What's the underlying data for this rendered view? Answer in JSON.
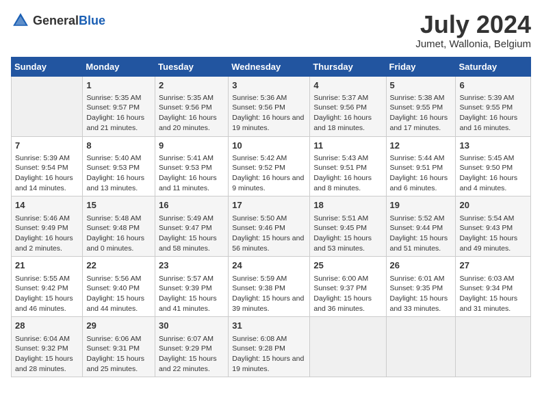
{
  "logo": {
    "text_general": "General",
    "text_blue": "Blue"
  },
  "title": "July 2024",
  "subtitle": "Jumet, Wallonia, Belgium",
  "days_header": [
    "Sunday",
    "Monday",
    "Tuesday",
    "Wednesday",
    "Thursday",
    "Friday",
    "Saturday"
  ],
  "weeks": [
    [
      {
        "day": "",
        "sunrise": "",
        "sunset": "",
        "daylight": ""
      },
      {
        "day": "1",
        "sunrise": "Sunrise: 5:35 AM",
        "sunset": "Sunset: 9:57 PM",
        "daylight": "Daylight: 16 hours and 21 minutes."
      },
      {
        "day": "2",
        "sunrise": "Sunrise: 5:35 AM",
        "sunset": "Sunset: 9:56 PM",
        "daylight": "Daylight: 16 hours and 20 minutes."
      },
      {
        "day": "3",
        "sunrise": "Sunrise: 5:36 AM",
        "sunset": "Sunset: 9:56 PM",
        "daylight": "Daylight: 16 hours and 19 minutes."
      },
      {
        "day": "4",
        "sunrise": "Sunrise: 5:37 AM",
        "sunset": "Sunset: 9:56 PM",
        "daylight": "Daylight: 16 hours and 18 minutes."
      },
      {
        "day": "5",
        "sunrise": "Sunrise: 5:38 AM",
        "sunset": "Sunset: 9:55 PM",
        "daylight": "Daylight: 16 hours and 17 minutes."
      },
      {
        "day": "6",
        "sunrise": "Sunrise: 5:39 AM",
        "sunset": "Sunset: 9:55 PM",
        "daylight": "Daylight: 16 hours and 16 minutes."
      }
    ],
    [
      {
        "day": "7",
        "sunrise": "Sunrise: 5:39 AM",
        "sunset": "Sunset: 9:54 PM",
        "daylight": "Daylight: 16 hours and 14 minutes."
      },
      {
        "day": "8",
        "sunrise": "Sunrise: 5:40 AM",
        "sunset": "Sunset: 9:53 PM",
        "daylight": "Daylight: 16 hours and 13 minutes."
      },
      {
        "day": "9",
        "sunrise": "Sunrise: 5:41 AM",
        "sunset": "Sunset: 9:53 PM",
        "daylight": "Daylight: 16 hours and 11 minutes."
      },
      {
        "day": "10",
        "sunrise": "Sunrise: 5:42 AM",
        "sunset": "Sunset: 9:52 PM",
        "daylight": "Daylight: 16 hours and 9 minutes."
      },
      {
        "day": "11",
        "sunrise": "Sunrise: 5:43 AM",
        "sunset": "Sunset: 9:51 PM",
        "daylight": "Daylight: 16 hours and 8 minutes."
      },
      {
        "day": "12",
        "sunrise": "Sunrise: 5:44 AM",
        "sunset": "Sunset: 9:51 PM",
        "daylight": "Daylight: 16 hours and 6 minutes."
      },
      {
        "day": "13",
        "sunrise": "Sunrise: 5:45 AM",
        "sunset": "Sunset: 9:50 PM",
        "daylight": "Daylight: 16 hours and 4 minutes."
      }
    ],
    [
      {
        "day": "14",
        "sunrise": "Sunrise: 5:46 AM",
        "sunset": "Sunset: 9:49 PM",
        "daylight": "Daylight: 16 hours and 2 minutes."
      },
      {
        "day": "15",
        "sunrise": "Sunrise: 5:48 AM",
        "sunset": "Sunset: 9:48 PM",
        "daylight": "Daylight: 16 hours and 0 minutes."
      },
      {
        "day": "16",
        "sunrise": "Sunrise: 5:49 AM",
        "sunset": "Sunset: 9:47 PM",
        "daylight": "Daylight: 15 hours and 58 minutes."
      },
      {
        "day": "17",
        "sunrise": "Sunrise: 5:50 AM",
        "sunset": "Sunset: 9:46 PM",
        "daylight": "Daylight: 15 hours and 56 minutes."
      },
      {
        "day": "18",
        "sunrise": "Sunrise: 5:51 AM",
        "sunset": "Sunset: 9:45 PM",
        "daylight": "Daylight: 15 hours and 53 minutes."
      },
      {
        "day": "19",
        "sunrise": "Sunrise: 5:52 AM",
        "sunset": "Sunset: 9:44 PM",
        "daylight": "Daylight: 15 hours and 51 minutes."
      },
      {
        "day": "20",
        "sunrise": "Sunrise: 5:54 AM",
        "sunset": "Sunset: 9:43 PM",
        "daylight": "Daylight: 15 hours and 49 minutes."
      }
    ],
    [
      {
        "day": "21",
        "sunrise": "Sunrise: 5:55 AM",
        "sunset": "Sunset: 9:42 PM",
        "daylight": "Daylight: 15 hours and 46 minutes."
      },
      {
        "day": "22",
        "sunrise": "Sunrise: 5:56 AM",
        "sunset": "Sunset: 9:40 PM",
        "daylight": "Daylight: 15 hours and 44 minutes."
      },
      {
        "day": "23",
        "sunrise": "Sunrise: 5:57 AM",
        "sunset": "Sunset: 9:39 PM",
        "daylight": "Daylight: 15 hours and 41 minutes."
      },
      {
        "day": "24",
        "sunrise": "Sunrise: 5:59 AM",
        "sunset": "Sunset: 9:38 PM",
        "daylight": "Daylight: 15 hours and 39 minutes."
      },
      {
        "day": "25",
        "sunrise": "Sunrise: 6:00 AM",
        "sunset": "Sunset: 9:37 PM",
        "daylight": "Daylight: 15 hours and 36 minutes."
      },
      {
        "day": "26",
        "sunrise": "Sunrise: 6:01 AM",
        "sunset": "Sunset: 9:35 PM",
        "daylight": "Daylight: 15 hours and 33 minutes."
      },
      {
        "day": "27",
        "sunrise": "Sunrise: 6:03 AM",
        "sunset": "Sunset: 9:34 PM",
        "daylight": "Daylight: 15 hours and 31 minutes."
      }
    ],
    [
      {
        "day": "28",
        "sunrise": "Sunrise: 6:04 AM",
        "sunset": "Sunset: 9:32 PM",
        "daylight": "Daylight: 15 hours and 28 minutes."
      },
      {
        "day": "29",
        "sunrise": "Sunrise: 6:06 AM",
        "sunset": "Sunset: 9:31 PM",
        "daylight": "Daylight: 15 hours and 25 minutes."
      },
      {
        "day": "30",
        "sunrise": "Sunrise: 6:07 AM",
        "sunset": "Sunset: 9:29 PM",
        "daylight": "Daylight: 15 hours and 22 minutes."
      },
      {
        "day": "31",
        "sunrise": "Sunrise: 6:08 AM",
        "sunset": "Sunset: 9:28 PM",
        "daylight": "Daylight: 15 hours and 19 minutes."
      },
      {
        "day": "",
        "sunrise": "",
        "sunset": "",
        "daylight": ""
      },
      {
        "day": "",
        "sunrise": "",
        "sunset": "",
        "daylight": ""
      },
      {
        "day": "",
        "sunrise": "",
        "sunset": "",
        "daylight": ""
      }
    ]
  ]
}
